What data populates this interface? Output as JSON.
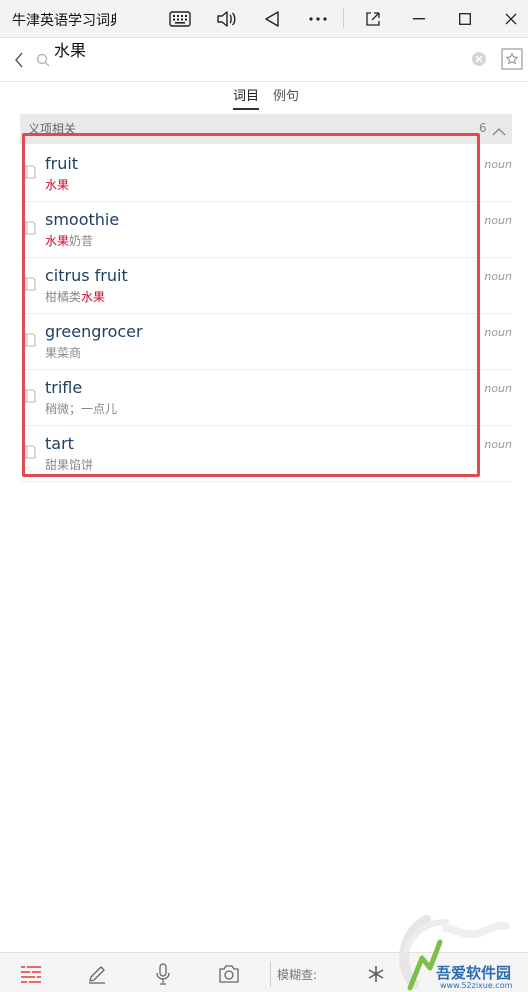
{
  "window": {
    "title": "牛津英语学习词典"
  },
  "search": {
    "query": "水果"
  },
  "tabs": [
    {
      "label": "词目",
      "active": true
    },
    {
      "label": "例句",
      "active": false
    }
  ],
  "section": {
    "title": "义项相关",
    "count": "6"
  },
  "entries": [
    {
      "word": "fruit",
      "def_hl": "水果",
      "def_rest": "",
      "pos": "noun"
    },
    {
      "word": "smoothie",
      "def_hl": "水果",
      "def_rest": "奶昔",
      "pos": "noun"
    },
    {
      "word": "citrus fruit",
      "def_pre": "柑橘类",
      "def_hl": "水果",
      "def_rest": "",
      "pos": "noun"
    },
    {
      "word": "greengrocer",
      "def_hl": "",
      "def_rest": "果菜商",
      "pos": "noun"
    },
    {
      "word": "trifle",
      "def_hl": "",
      "def_rest": "稍微；一点儿",
      "pos": "noun"
    },
    {
      "word": "tart",
      "def_hl": "",
      "def_rest": "甜果馅饼",
      "pos": "noun"
    }
  ],
  "bottom_toolbar": {
    "fuzzy_label": "模糊查:"
  },
  "watermark": {
    "name": "吾爱软件园",
    "url": "www.52zixue.com"
  },
  "colors": {
    "highlight": "#c8102e",
    "word": "#1e3f66",
    "annotation_box": "#e04b52",
    "toolbar_accent": "#e03b3b"
  }
}
